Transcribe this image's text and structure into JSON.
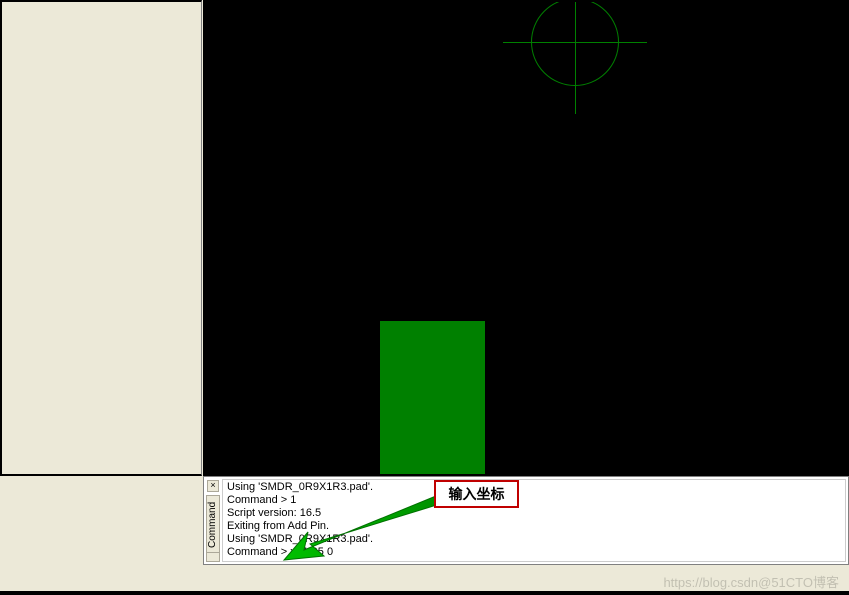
{
  "command_panel": {
    "tab_label": "Command",
    "close_glyph": "×",
    "history": [
      "Using 'SMDR_0R9X1R3.pad'.",
      "Command > 1",
      "Script version: 16.5",
      "Exiting from Add Pin.",
      "Using 'SMDR_0R9X1R3.pad'."
    ],
    "prompt": "Command > ",
    "input_value": "x -1.05 0"
  },
  "callout": {
    "label": "输入坐标"
  },
  "canvas": {
    "pad_color": "#008000",
    "marker_color": "#008000"
  },
  "watermark": "https://blog.csdn@51CTO博客"
}
